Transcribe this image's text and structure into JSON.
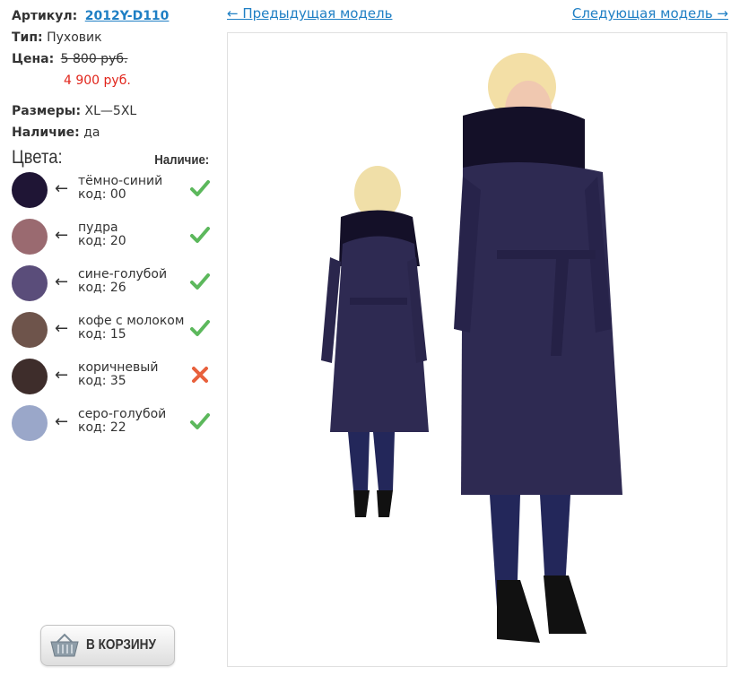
{
  "product": {
    "article_label": "Артикул:",
    "article_value": "2012Y-D110",
    "type_label": "Тип:",
    "type_value": "Пуховик",
    "price_label": "Цена:",
    "old_price": "5 800 руб.",
    "new_price": "4 900 руб.",
    "sizes_label": "Размеры:",
    "sizes_value": "XL—5XL",
    "stock_label": "Наличие:",
    "stock_value": "да"
  },
  "colors_section": {
    "title": "Цвета:",
    "availability_header": "Наличие:",
    "items": [
      {
        "arrow": "←",
        "name": "тёмно-синий",
        "code": "код: 00",
        "swatch": "#1f1535",
        "available": true,
        "status_icon": "check-icon"
      },
      {
        "arrow": "←",
        "name": "пудра",
        "code": "код: 20",
        "swatch": "#9a6a70",
        "available": true,
        "status_icon": "check-icon"
      },
      {
        "arrow": "←",
        "name": "сине-голубой",
        "code": "код: 26",
        "swatch": "#5a4d7a",
        "available": true,
        "status_icon": "check-icon"
      },
      {
        "arrow": "←",
        "name": "кофе с молоком",
        "code": "код: 15",
        "swatch": "#6e544b",
        "available": true,
        "status_icon": "check-icon"
      },
      {
        "arrow": "←",
        "name": "коричневый",
        "code": "код: 35",
        "swatch": "#3e2d2b",
        "available": false,
        "status_icon": "cross-icon"
      },
      {
        "arrow": "←",
        "name": "серо-голубой",
        "code": "код: 22",
        "swatch": "#9aa7c9",
        "available": true,
        "status_icon": "check-icon"
      }
    ]
  },
  "cart_button": {
    "label": "В КОРЗИНУ",
    "icon": "basket-icon"
  },
  "navigation": {
    "prev_label": "← Предыдущая модель",
    "next_label": "Следующая модель →"
  },
  "colors": {
    "link": "#1f7fc4",
    "sale_price": "#e1251b",
    "available": "#5cb85c",
    "unavailable": "#e8603c"
  }
}
